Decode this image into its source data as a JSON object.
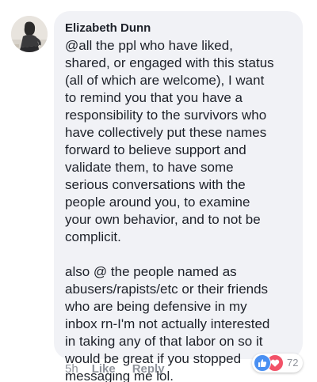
{
  "comment": {
    "author": "Elizabeth Dunn",
    "text": "@all the ppl who have liked,\nshared, or engaged with this status\n(all of which are welcome), I want\nto remind you that you have a\nresponsibility to the survivors who\nhave collectively put these names\nforward to believe support and\nvalidate them, to have some\nserious conversations with the\npeople around you, to examine\nyour own behavior, and to not be\ncomplicit.\n\nalso @ the people named as\nabusers/rapists/etc or their friends\nwho are being defensive in my\ninbox rn-I'm not actually interested\nin taking any of that labor on so it\nwould be great if you stopped\nmessaging me lol."
  },
  "actions": {
    "timestamp": "5h",
    "like_label": "Like",
    "reply_label": "Reply"
  },
  "reactions": {
    "icons": [
      "like-icon",
      "love-icon"
    ],
    "count": "72",
    "colors": {
      "like": "#4a90f2",
      "love": "#f25268"
    }
  },
  "colors": {
    "bubble_bg": "#f1f2f6",
    "text": "#1d2129",
    "meta": "#90949c"
  }
}
